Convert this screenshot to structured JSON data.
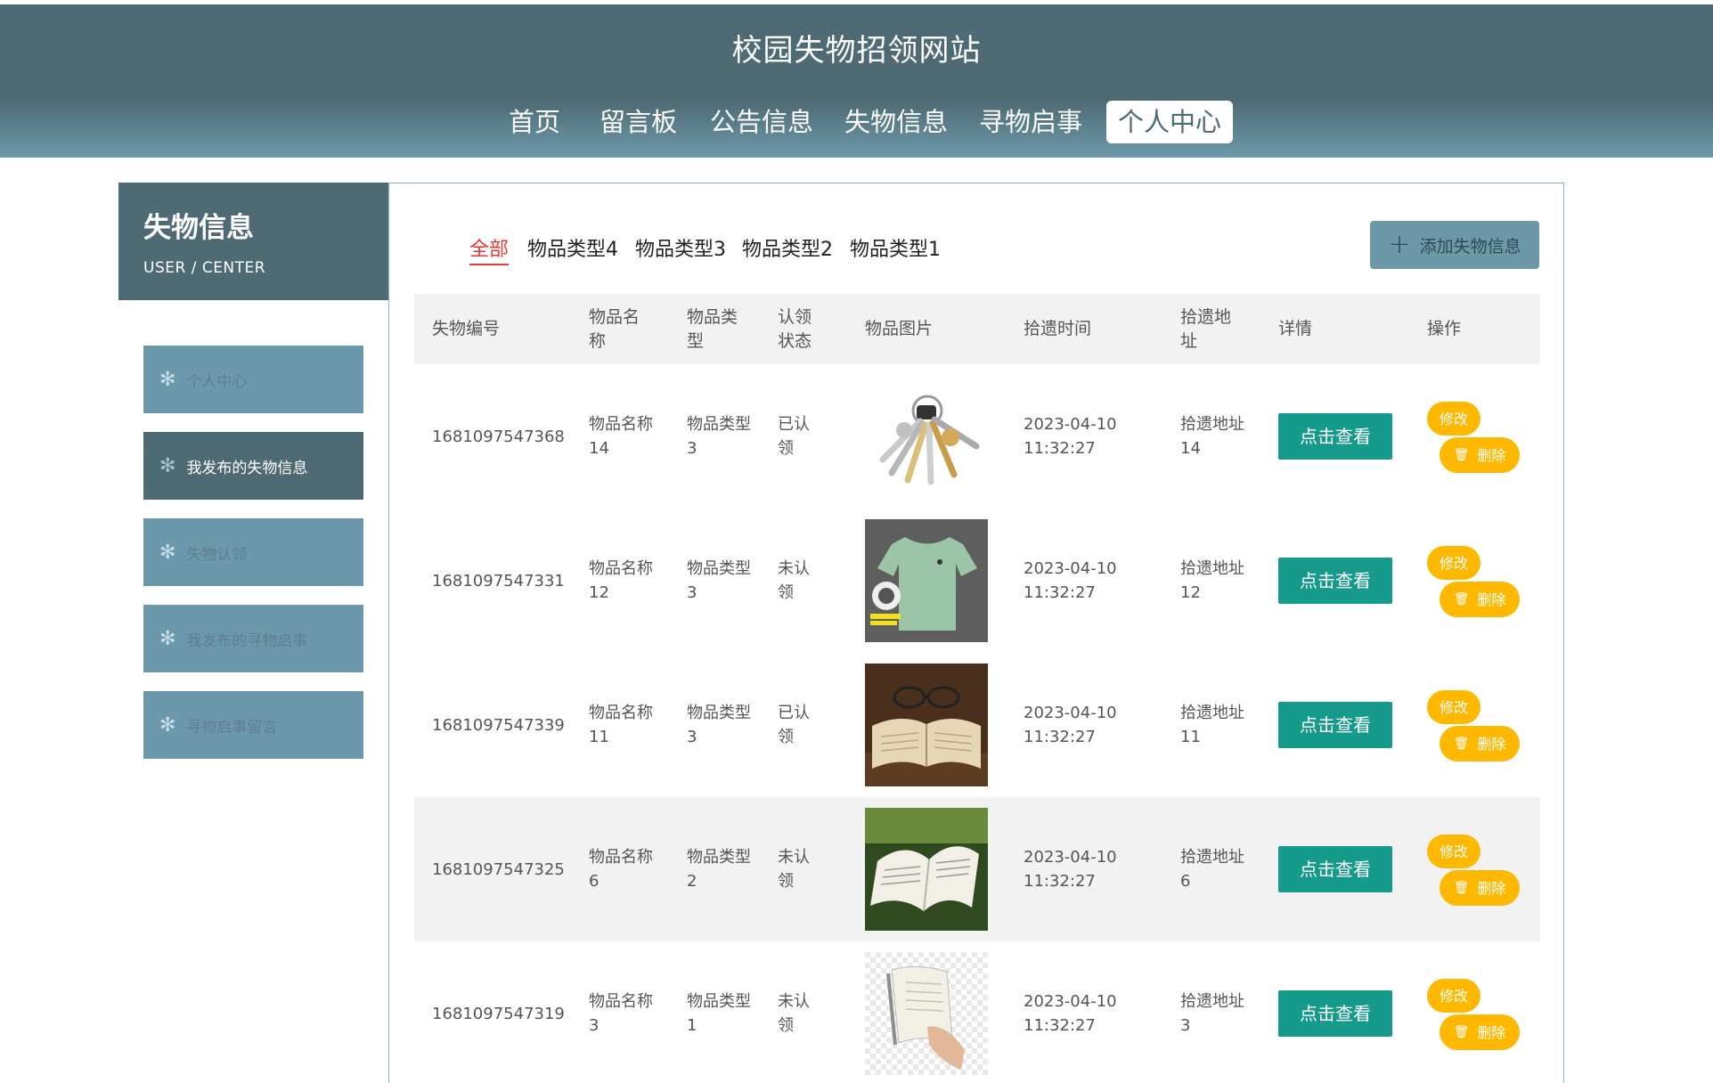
{
  "header": {
    "title": "校园失物招领网站",
    "nav": [
      "首页",
      "留言板",
      "公告信息",
      "失物信息",
      "寻物启事",
      "个人中心"
    ]
  },
  "sidebar": {
    "title": "失物信息",
    "subtitle": "USER / CENTER",
    "items": [
      {
        "label": "个人中心",
        "icon": "gear-icon"
      },
      {
        "label": "我发布的失物信息",
        "icon": "gear-icon"
      },
      {
        "label": "失物认领",
        "icon": "gear-icon"
      },
      {
        "label": "我发布的寻物启事",
        "icon": "gear-icon"
      },
      {
        "label": "寻物启事留言",
        "icon": "gear-icon"
      }
    ]
  },
  "filters": [
    "全部",
    "物品类型4",
    "物品类型3",
    "物品类型2",
    "物品类型1"
  ],
  "add_button": "添加失物信息",
  "table": {
    "headers": [
      "失物编号",
      "物品名称",
      "物品类型",
      "认领状态",
      "物品图片",
      "拾遗时间",
      "拾遗地址",
      "详情",
      "操作"
    ],
    "rows": [
      {
        "id": "1681097547368",
        "name": "物品名称14",
        "type": "物品类型3",
        "status": "已认领",
        "image": "keys-photo",
        "date": "2023-04-10",
        "time": "11:32:27",
        "addr": "拾遗地址14"
      },
      {
        "id": "1681097547331",
        "name": "物品名称12",
        "type": "物品类型3",
        "status": "未认领",
        "image": "tshirt-photo",
        "date": "2023-04-10",
        "time": "11:32:27",
        "addr": "拾遗地址12"
      },
      {
        "id": "1681097547339",
        "name": "物品名称11",
        "type": "物品类型3",
        "status": "已认领",
        "image": "book-glasses-photo",
        "date": "2023-04-10",
        "time": "11:32:27",
        "addr": "拾遗地址11"
      },
      {
        "id": "1681097547325",
        "name": "物品名称6",
        "type": "物品类型2",
        "status": "未认领",
        "image": "book-grass-photo",
        "date": "2023-04-10",
        "time": "11:32:27",
        "addr": "拾遗地址6"
      },
      {
        "id": "1681097547319",
        "name": "物品名称3",
        "type": "物品类型1",
        "status": "未认领",
        "image": "book-hand-photo",
        "date": "2023-04-10",
        "time": "11:32:27",
        "addr": "拾遗地址3"
      }
    ],
    "view_label": "点击查看",
    "edit_label": "修改",
    "delete_label": "删除"
  },
  "colors": {
    "header_dark": "#4e6a75",
    "header_light": "#6d9aab",
    "sidebar_item": "#6b99ab",
    "view_button": "#159a8c",
    "action_button": "#ffb800",
    "filter_active": "#e53935"
  }
}
